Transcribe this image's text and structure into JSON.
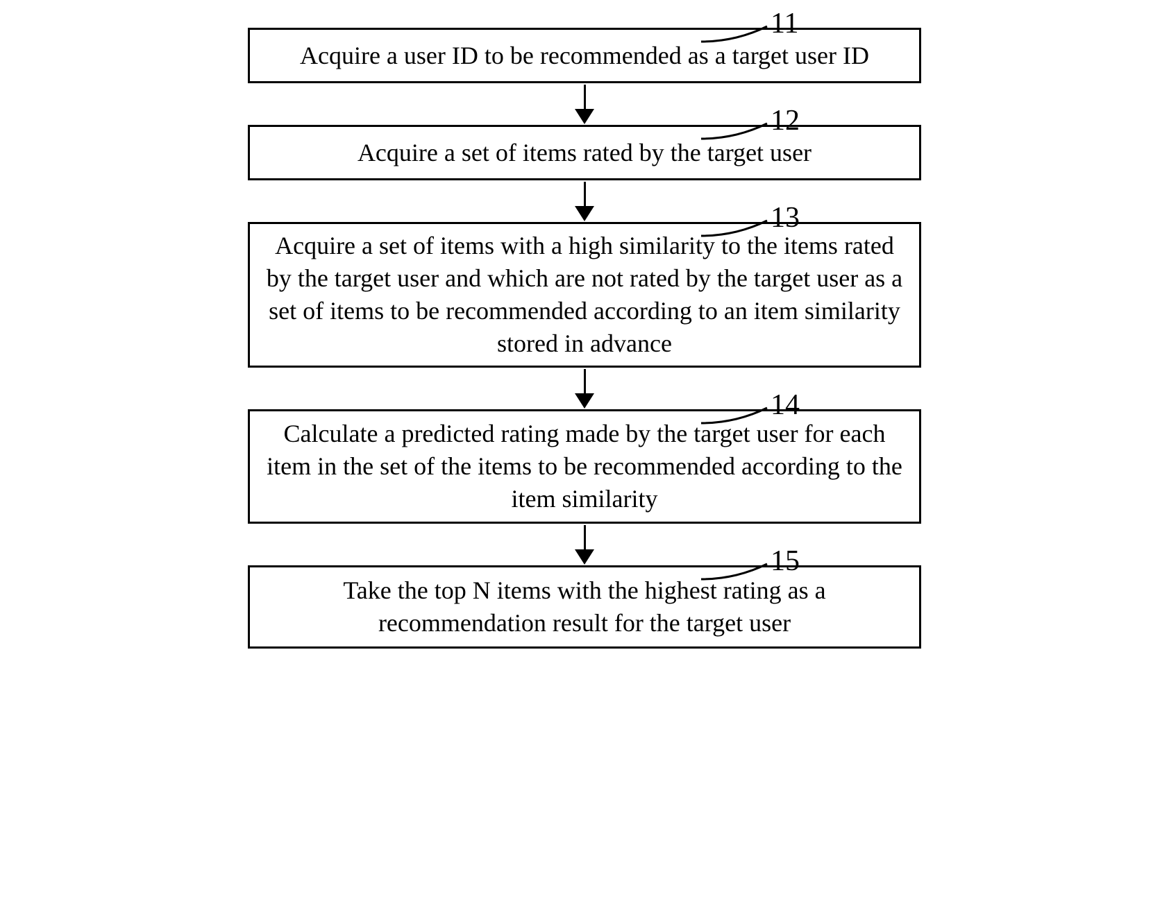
{
  "flowchart": {
    "steps": [
      {
        "id": "step-11",
        "label": "11",
        "text": "Acquire a user ID to be recommended as a target user ID"
      },
      {
        "id": "step-12",
        "label": "12",
        "text": "Acquire a set of items rated by the target user"
      },
      {
        "id": "step-13",
        "label": "13",
        "text": "Acquire a set of items with a high similarity to the items rated by the target user and which are not rated by the target user as a set of items to be recommended according to an item similarity stored in advance"
      },
      {
        "id": "step-14",
        "label": "14",
        "text": "Calculate a predicted rating made by the target user for each item in the set of the items to be recommended according to the item similarity"
      },
      {
        "id": "step-15",
        "label": "15",
        "text": "Take the top N items with the highest rating as a recommendation result for the target user"
      }
    ]
  }
}
